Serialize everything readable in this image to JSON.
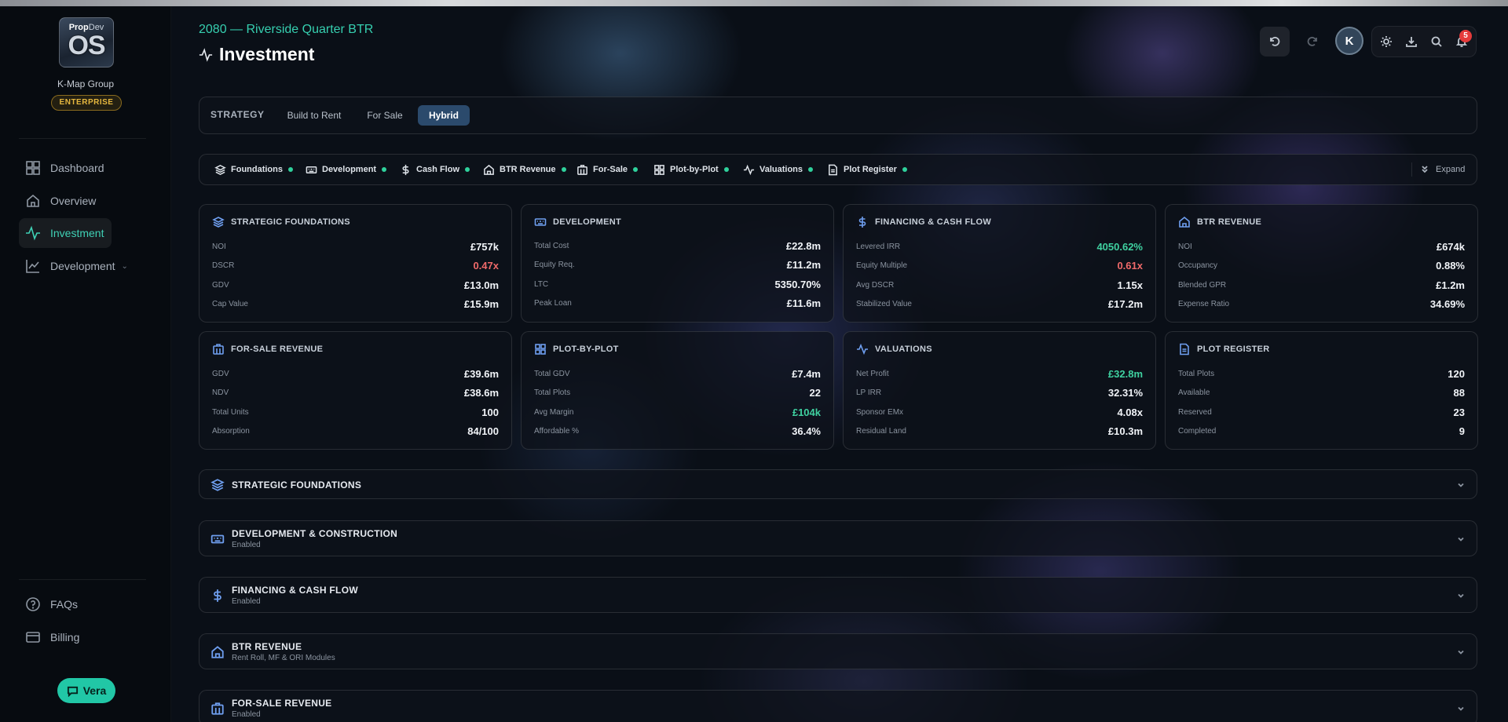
{
  "sidebar": {
    "logo_top": "Prop",
    "logo_top_b": "Dev",
    "logo_main": "OS",
    "org_name": "K-Map Group",
    "plan_badge": "ENTERPRISE",
    "nav": [
      "Dashboard",
      "Overview",
      "Investment",
      "Development"
    ],
    "footer": [
      "FAQs",
      "Billing"
    ],
    "assistant": "Vera"
  },
  "header": {
    "project": "2080 — Riverside Quarter BTR",
    "title": "Investment",
    "avatar_initial": "K",
    "notification_count": "5"
  },
  "strategy": {
    "label": "STRATEGY",
    "options": [
      "Build to Rent",
      "For Sale",
      "Hybrid"
    ],
    "selected": "Hybrid"
  },
  "tabs": [
    "Foundations",
    "Development",
    "Cash Flow",
    "BTR Revenue",
    "For-Sale",
    "Plot-by-Plot",
    "Valuations",
    "Plot Register"
  ],
  "expand_label": "Expand",
  "cards": [
    {
      "title": "STRATEGIC FOUNDATIONS",
      "rows": [
        [
          "NOI",
          "£757k"
        ],
        [
          "DSCR",
          "0.47x"
        ],
        [
          "GDV",
          "£13.0m"
        ],
        [
          "Cap Value",
          "£15.9m"
        ]
      ]
    },
    {
      "title": "DEVELOPMENT",
      "rows": [
        [
          "Total Cost",
          "£22.8m"
        ],
        [
          "Equity Req.",
          "£11.2m"
        ],
        [
          "LTC",
          "5350.70%"
        ],
        [
          "Peak Loan",
          "£11.6m"
        ]
      ]
    },
    {
      "title": "FINANCING & CASH FLOW",
      "rows": [
        [
          "Levered IRR",
          "4050.62%"
        ],
        [
          "Equity Multiple",
          "0.61x"
        ],
        [
          "Avg DSCR",
          "1.15x"
        ],
        [
          "Stabilized Value",
          "£17.2m"
        ]
      ]
    },
    {
      "title": "BTR REVENUE",
      "rows": [
        [
          "NOI",
          "£674k"
        ],
        [
          "Occupancy",
          "0.88%"
        ],
        [
          "Blended GPR",
          "£1.2m"
        ],
        [
          "Expense Ratio",
          "34.69%"
        ]
      ]
    },
    {
      "title": "FOR-SALE REVENUE",
      "rows": [
        [
          "GDV",
          "£39.6m"
        ],
        [
          "NDV",
          "£38.6m"
        ],
        [
          "Total Units",
          "100"
        ],
        [
          "Absorption",
          "84/100"
        ]
      ]
    },
    {
      "title": "PLOT-BY-PLOT",
      "rows": [
        [
          "Total GDV",
          "£7.4m"
        ],
        [
          "Total Plots",
          "22"
        ],
        [
          "Avg Margin",
          "£104k"
        ],
        [
          "Affordable %",
          "36.4%"
        ]
      ]
    },
    {
      "title": "VALUATIONS",
      "rows": [
        [
          "Net Profit",
          "£32.8m"
        ],
        [
          "LP IRR",
          "32.31%"
        ],
        [
          "Sponsor EMx",
          "4.08x"
        ],
        [
          "Residual Land",
          "£10.3m"
        ]
      ]
    },
    {
      "title": "PLOT REGISTER",
      "rows": [
        [
          "Total Plots",
          "120"
        ],
        [
          "Available",
          "88"
        ],
        [
          "Reserved",
          "23"
        ],
        [
          "Completed",
          "9"
        ]
      ]
    }
  ],
  "sections": [
    {
      "title": "STRATEGIC FOUNDATIONS",
      "subtitle": ""
    },
    {
      "title": "DEVELOPMENT & CONSTRUCTION",
      "subtitle": "Enabled"
    },
    {
      "title": "FINANCING & CASH FLOW",
      "subtitle": "Enabled"
    },
    {
      "title": "BTR REVENUE",
      "subtitle": "Rent Roll, MF & ORI Modules"
    },
    {
      "title": "FOR-SALE REVENUE",
      "subtitle": "Enabled"
    }
  ],
  "colors": {
    "accent": "#36cfb0",
    "active_seg": "#2b4a6c",
    "negative": "#f06a6a",
    "positive": "#3fd1a0",
    "badge": "#e5b73f"
  }
}
